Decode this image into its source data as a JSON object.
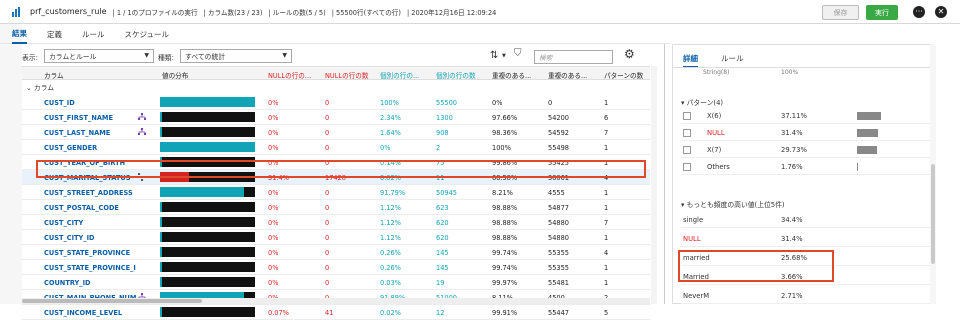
{
  "header": {
    "title": "prf_customers_rule",
    "seg1": "| 1 / 1のプロファイルの実行",
    "seg2": "| カラム数(23 / 23)",
    "seg3": "| ルールの数(5 / 5)",
    "seg4": "| 55500行(すべての行)",
    "seg5": "| 2020年12月16日 12:09:24",
    "save_label": "保存",
    "run_label": "実行",
    "more_icon": "ellipsis-icon",
    "close_icon": "close-icon"
  },
  "tabs": [
    "結果",
    "定義",
    "ルール",
    "スケジュール"
  ],
  "filter": {
    "display_label": "表示:",
    "display_value": "カラムとルール",
    "type_label": "種類:",
    "type_value": "すべての統計",
    "search_placeholder": "検索"
  },
  "columns": [
    "カラム",
    "値の分布",
    "NULLの行の...",
    "NULLの行の数",
    "個別の行の...",
    "個別の行の数",
    "重複のある...",
    "重複のある...",
    "パターンの数"
  ],
  "group_label": "カラム",
  "rows": [
    {
      "name": "CUST_ID",
      "null_pct": "0%",
      "null_n": "0",
      "dist_pct": "100%",
      "dist_n": "55500",
      "dup_pct": "0%",
      "dup_n": "0",
      "pat": "1",
      "icon": ""
    },
    {
      "name": "CUST_FIRST_NAME",
      "null_pct": "0%",
      "null_n": "0",
      "dist_pct": "2.34%",
      "dist_n": "1300",
      "dup_pct": "97.66%",
      "dup_n": "54200",
      "pat": "6",
      "icon": "hierarchy-icon"
    },
    {
      "name": "CUST_LAST_NAME",
      "null_pct": "0%",
      "null_n": "0",
      "dist_pct": "1.64%",
      "dist_n": "908",
      "dup_pct": "98.36%",
      "dup_n": "54592",
      "pat": "7",
      "icon": "hierarchy-icon"
    },
    {
      "name": "CUST_GENDER",
      "null_pct": "0%",
      "null_n": "0",
      "dist_pct": "0%",
      "dist_n": "2",
      "dup_pct": "100%",
      "dup_n": "55498",
      "pat": "1",
      "icon": ""
    },
    {
      "name": "CUST_YEAR_OF_BIRTH",
      "null_pct": "0%",
      "null_n": "0",
      "dist_pct": "0.14%",
      "dist_n": "75",
      "dup_pct": "99.86%",
      "dup_n": "55425",
      "pat": "1",
      "icon": ""
    },
    {
      "name": "CUST_MARITAL_STATUS",
      "null_pct": "31.4%",
      "null_n": "17428",
      "dist_pct": "0.02%",
      "dist_n": "11",
      "dup_pct": "68.58%",
      "dup_n": "38061",
      "pat": "4",
      "icon": "tree-icon"
    },
    {
      "name": "CUST_STREET_ADDRESS",
      "null_pct": "0%",
      "null_n": "0",
      "dist_pct": "91.79%",
      "dist_n": "50945",
      "dup_pct": "8.21%",
      "dup_n": "4555",
      "pat": "1",
      "icon": ""
    },
    {
      "name": "CUST_POSTAL_CODE",
      "null_pct": "0%",
      "null_n": "0",
      "dist_pct": "1.12%",
      "dist_n": "623",
      "dup_pct": "98.88%",
      "dup_n": "54877",
      "pat": "1",
      "icon": ""
    },
    {
      "name": "CUST_CITY",
      "null_pct": "0%",
      "null_n": "0",
      "dist_pct": "1.12%",
      "dist_n": "620",
      "dup_pct": "98.88%",
      "dup_n": "54880",
      "pat": "7",
      "icon": ""
    },
    {
      "name": "CUST_CITY_ID",
      "null_pct": "0%",
      "null_n": "0",
      "dist_pct": "1.12%",
      "dist_n": "620",
      "dup_pct": "98.88%",
      "dup_n": "54880",
      "pat": "1",
      "icon": ""
    },
    {
      "name": "CUST_STATE_PROVINCE",
      "null_pct": "0%",
      "null_n": "0",
      "dist_pct": "0.26%",
      "dist_n": "145",
      "dup_pct": "99.74%",
      "dup_n": "55355",
      "pat": "4",
      "icon": ""
    },
    {
      "name": "CUST_STATE_PROVINCE_ID",
      "null_pct": "0%",
      "null_n": "0",
      "dist_pct": "0.26%",
      "dist_n": "145",
      "dup_pct": "99.74%",
      "dup_n": "55355",
      "pat": "1",
      "icon": ""
    },
    {
      "name": "COUNTRY_ID",
      "null_pct": "0%",
      "null_n": "0",
      "dist_pct": "0.03%",
      "dist_n": "19",
      "dup_pct": "99.97%",
      "dup_n": "55481",
      "pat": "1",
      "icon": ""
    },
    {
      "name": "CUST_MAIN_PHONE_NUM...",
      "null_pct": "0%",
      "null_n": "0",
      "dist_pct": "91.89%",
      "dist_n": "51000",
      "dup_pct": "8.11%",
      "dup_n": "4500",
      "pat": "2",
      "icon": "hierarchy-icon"
    },
    {
      "name": "CUST_INCOME_LEVEL",
      "null_pct": "0.07%",
      "null_n": "41",
      "dist_pct": "0.02%",
      "dist_n": "12",
      "dup_pct": "99.91%",
      "dup_n": "55447",
      "pat": "5",
      "icon": ""
    }
  ],
  "right_panel": {
    "tab_detail": "詳細",
    "tab_rule": "ルール",
    "top_partial_label": "String(8)",
    "top_partial_value": "100%",
    "patterns_title": "▾ パターン(4)",
    "patterns": [
      {
        "label": "X(6)",
        "pct": "37.11%",
        "fill": 0.3711
      },
      {
        "label": "NULL",
        "pct": "31.4%",
        "fill": 0.314
      },
      {
        "label": "X(7)",
        "pct": "29.73%",
        "fill": 0.2973
      },
      {
        "label": "Others",
        "pct": "1.76%",
        "fill": 0.0176
      }
    ],
    "frequent_title": "▾ もっとも頻度の高い値(上位5件)",
    "frequent": [
      {
        "label": "single",
        "pct": "34.4%"
      },
      {
        "label": "NULL",
        "pct": "31.4%"
      },
      {
        "label": "married",
        "pct": "25.68%"
      },
      {
        "label": "Married",
        "pct": "3.66%"
      },
      {
        "label": "NeverM",
        "pct": "2.71%"
      }
    ]
  },
  "colors": {
    "accent": "#0b5ea8",
    "teal": "#10a4b6",
    "red": "#d22222",
    "run": "#3aa845",
    "highlight": "#e0482a"
  }
}
